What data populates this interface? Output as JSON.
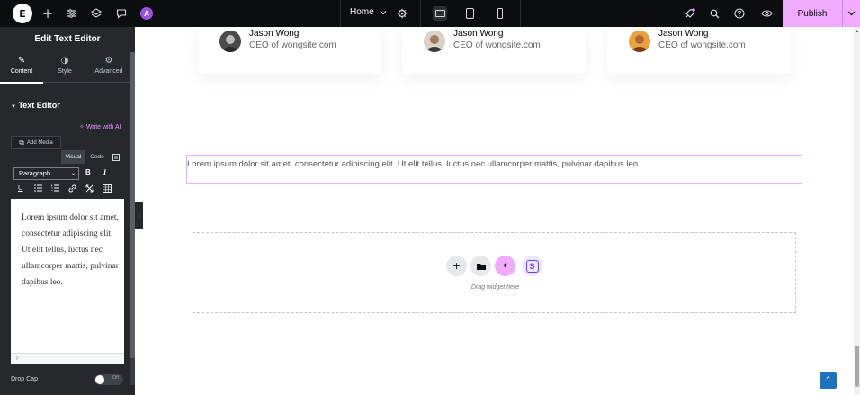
{
  "topbar": {
    "logo": "E",
    "add_icon": "+",
    "ai_badge": "A",
    "page_selector": "Home",
    "publish_label": "Publish"
  },
  "panel": {
    "title": "Edit Text Editor",
    "tabs": [
      {
        "label": "Content",
        "icon": "pencil-icon"
      },
      {
        "label": "Style",
        "icon": "half-circle-icon"
      },
      {
        "label": "Advanced",
        "icon": "gear-icon"
      }
    ],
    "section_title": "Text Editor",
    "write_ai": "Write with AI",
    "add_media": "Add Media",
    "editor_tabs": {
      "visual": "Visual",
      "code": "Code"
    },
    "format_select": "Paragraph",
    "bold": "B",
    "italic": "I",
    "underline": "U",
    "editor_content": "Lorem ipsum dolor sit amet, consectetur adipiscing elit. Ut elit tellus, luctus nec ullamcorper mattis, pulvinar dapibus leo.",
    "editor_footer": "p",
    "drop_cap_label": "Drop Cap",
    "drop_cap_state": "Off"
  },
  "canvas": {
    "testimonials": [
      {
        "name": "Jason Wong",
        "role": "CEO of wongsite.com"
      },
      {
        "name": "Jason Wong",
        "role": "CEO of wongsite.com"
      },
      {
        "name": "Jason Wong",
        "role": "CEO of wongsite.com"
      }
    ],
    "text_widget": "Lorem ipsum dolor sit amet, consectetur adipiscing elit. Ut elit tellus, luctus nec ullamcorper mattis, pulvinar dapibus leo.",
    "drop_zone_label": "Drag widget here",
    "drop_zone_buttons": {
      "add": "+",
      "template": "■",
      "ai": "✦",
      "site": "S"
    }
  },
  "colors": {
    "accent": "#f0abfc",
    "panel_bg": "#26292c",
    "topbar_bg": "#0c0d0e",
    "ai_purple": "#9b51e0"
  }
}
